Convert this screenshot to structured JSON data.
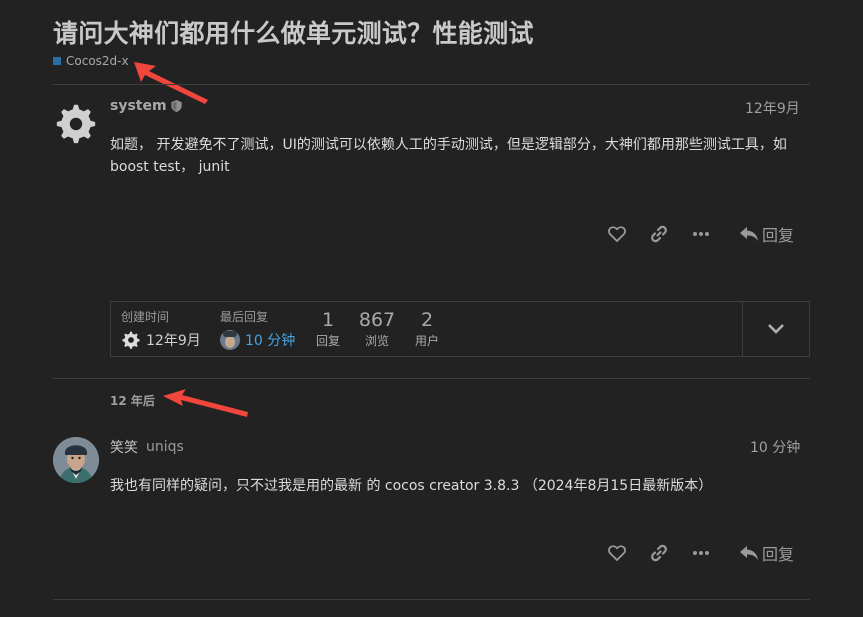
{
  "topic": {
    "title": "请问大神们都用什么做单元测试？性能测试",
    "category": {
      "label": "Cocos2d-x",
      "color": "#2a6fa8"
    }
  },
  "posts": [
    {
      "username": "system",
      "display_name": "",
      "date": "12年9月",
      "body": "如题， 开发避免不了测试，UI的测试可以依赖人工的手动测试，但是逻辑部分，大神们都用那些测试工具，如boost test， junit",
      "avatar_icon": "gear-icon",
      "badge_icon": "shield-icon"
    },
    {
      "username": "uniqs",
      "display_name": "笑笑",
      "date": "10 分钟",
      "body": "我也有同样的疑问，只不过我是用的最新 的 cocos creator 3.8.3 （2024年8月15日最新版本）",
      "avatar_icon": "avatar"
    }
  ],
  "actions": {
    "like_icon": "heart-icon",
    "link_icon": "link-icon",
    "more_icon": "ellipsis-icon",
    "reply_label": "回复"
  },
  "topic_map": {
    "created_label": "创建时间",
    "created_value": "12年9月",
    "last_reply_label": "最后回复",
    "last_reply_value": "10 分钟",
    "stats": [
      {
        "value": "1",
        "label": "回复"
      },
      {
        "value": "867",
        "label": "浏览"
      },
      {
        "value": "2",
        "label": "用户"
      }
    ],
    "expand_icon": "chevron-down-icon"
  },
  "time_gap": "12 年后",
  "colors": {
    "background": "#222222",
    "accent_link": "#4aa3df",
    "annotation_arrow": "#f0463c"
  }
}
